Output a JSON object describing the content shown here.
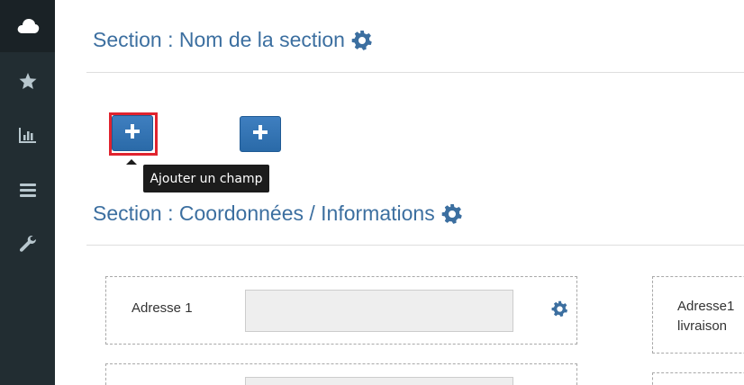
{
  "sidebar": {
    "items": [
      {
        "icon": "cloud-icon",
        "active": true
      },
      {
        "icon": "star-icon"
      },
      {
        "icon": "bar-chart-icon"
      },
      {
        "icon": "list-icon"
      },
      {
        "icon": "wrench-icon"
      }
    ]
  },
  "sections": [
    {
      "title": "Section : Nom de la section",
      "gear_icon": "gear-icon"
    },
    {
      "title": "Section : Coordonnées / Informations",
      "gear_icon": "gear-icon"
    }
  ],
  "add_buttons": {
    "icon": "plus-icon",
    "tooltip": "Ajouter un champ"
  },
  "fields": [
    {
      "label": "Adresse 1",
      "value": ""
    },
    {
      "label": "Adresse1\nlivraison",
      "value": ""
    }
  ],
  "colors": {
    "sidebar_bg": "#222d32",
    "title": "#3c6fa0",
    "button": "#2f6fad",
    "highlight": "#e0232e"
  }
}
